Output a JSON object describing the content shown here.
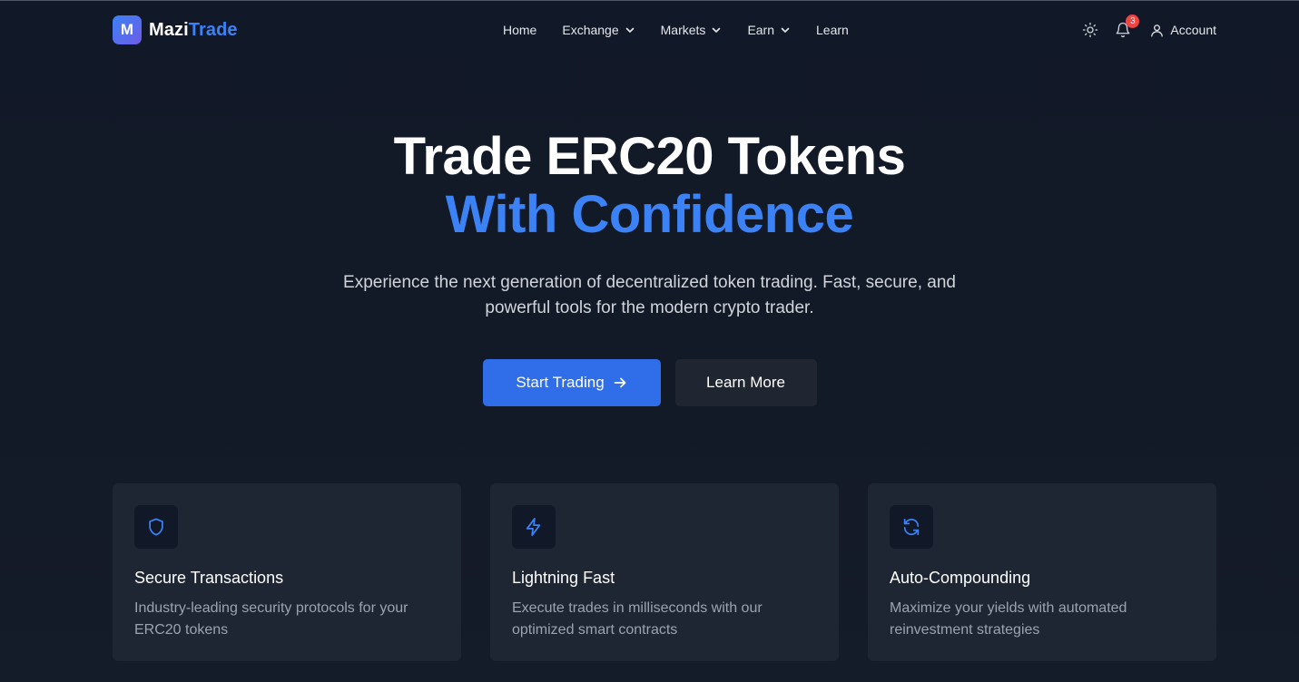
{
  "brand": {
    "badge": "M",
    "name_part1": "Mazi",
    "name_part2": "Trade"
  },
  "nav": {
    "items": [
      {
        "label": "Home",
        "dropdown": false
      },
      {
        "label": "Exchange",
        "dropdown": true
      },
      {
        "label": "Markets",
        "dropdown": true
      },
      {
        "label": "Earn",
        "dropdown": true
      },
      {
        "label": "Learn",
        "dropdown": false
      }
    ],
    "notifications_count": "3",
    "account_label": "Account",
    "icons": [
      "sun-icon",
      "bell-icon",
      "user-icon",
      "chevron-down-icon"
    ]
  },
  "hero": {
    "title_line1": "Trade ERC20 Tokens",
    "title_line2": "With Confidence",
    "subtitle": "Experience the next generation of decentralized token trading. Fast, secure, and powerful tools for the modern crypto trader.",
    "primary_cta": "Start Trading",
    "secondary_cta": "Learn More"
  },
  "features": [
    {
      "icon": "shield-icon",
      "title": "Secure Transactions",
      "description": "Industry-leading security protocols for your ERC20 tokens"
    },
    {
      "icon": "lightning-icon",
      "title": "Lightning Fast",
      "description": "Execute trades in milliseconds with our optimized smart contracts"
    },
    {
      "icon": "refresh-icon",
      "title": "Auto-Compounding",
      "description": "Maximize your yields with automated reinvestment strategies"
    }
  ],
  "colors": {
    "background": "#111827",
    "accent": "#3b82f6",
    "primary_button": "#2f6ee8",
    "card": "#1e2633",
    "badge": "#ef4444"
  }
}
